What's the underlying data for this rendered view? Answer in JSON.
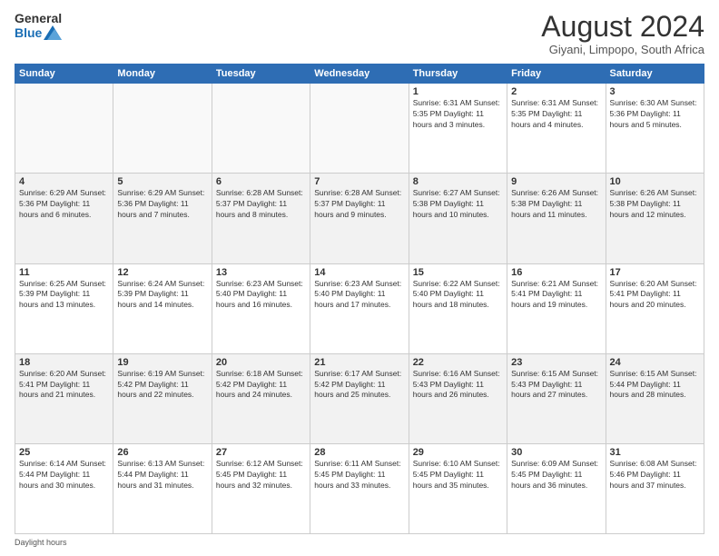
{
  "header": {
    "logo_general": "General",
    "logo_blue": "Blue",
    "title": "August 2024",
    "subtitle": "Giyani, Limpopo, South Africa"
  },
  "calendar": {
    "days_of_week": [
      "Sunday",
      "Monday",
      "Tuesday",
      "Wednesday",
      "Thursday",
      "Friday",
      "Saturday"
    ],
    "weeks": [
      [
        {
          "day": "",
          "info": "",
          "empty": true
        },
        {
          "day": "",
          "info": "",
          "empty": true
        },
        {
          "day": "",
          "info": "",
          "empty": true
        },
        {
          "day": "",
          "info": "",
          "empty": true
        },
        {
          "day": "1",
          "info": "Sunrise: 6:31 AM\nSunset: 5:35 PM\nDaylight: 11 hours\nand 3 minutes.",
          "empty": false
        },
        {
          "day": "2",
          "info": "Sunrise: 6:31 AM\nSunset: 5:35 PM\nDaylight: 11 hours\nand 4 minutes.",
          "empty": false
        },
        {
          "day": "3",
          "info": "Sunrise: 6:30 AM\nSunset: 5:36 PM\nDaylight: 11 hours\nand 5 minutes.",
          "empty": false
        }
      ],
      [
        {
          "day": "4",
          "info": "Sunrise: 6:29 AM\nSunset: 5:36 PM\nDaylight: 11 hours\nand 6 minutes.",
          "empty": false
        },
        {
          "day": "5",
          "info": "Sunrise: 6:29 AM\nSunset: 5:36 PM\nDaylight: 11 hours\nand 7 minutes.",
          "empty": false
        },
        {
          "day": "6",
          "info": "Sunrise: 6:28 AM\nSunset: 5:37 PM\nDaylight: 11 hours\nand 8 minutes.",
          "empty": false
        },
        {
          "day": "7",
          "info": "Sunrise: 6:28 AM\nSunset: 5:37 PM\nDaylight: 11 hours\nand 9 minutes.",
          "empty": false
        },
        {
          "day": "8",
          "info": "Sunrise: 6:27 AM\nSunset: 5:38 PM\nDaylight: 11 hours\nand 10 minutes.",
          "empty": false
        },
        {
          "day": "9",
          "info": "Sunrise: 6:26 AM\nSunset: 5:38 PM\nDaylight: 11 hours\nand 11 minutes.",
          "empty": false
        },
        {
          "day": "10",
          "info": "Sunrise: 6:26 AM\nSunset: 5:38 PM\nDaylight: 11 hours\nand 12 minutes.",
          "empty": false
        }
      ],
      [
        {
          "day": "11",
          "info": "Sunrise: 6:25 AM\nSunset: 5:39 PM\nDaylight: 11 hours\nand 13 minutes.",
          "empty": false
        },
        {
          "day": "12",
          "info": "Sunrise: 6:24 AM\nSunset: 5:39 PM\nDaylight: 11 hours\nand 14 minutes.",
          "empty": false
        },
        {
          "day": "13",
          "info": "Sunrise: 6:23 AM\nSunset: 5:40 PM\nDaylight: 11 hours\nand 16 minutes.",
          "empty": false
        },
        {
          "day": "14",
          "info": "Sunrise: 6:23 AM\nSunset: 5:40 PM\nDaylight: 11 hours\nand 17 minutes.",
          "empty": false
        },
        {
          "day": "15",
          "info": "Sunrise: 6:22 AM\nSunset: 5:40 PM\nDaylight: 11 hours\nand 18 minutes.",
          "empty": false
        },
        {
          "day": "16",
          "info": "Sunrise: 6:21 AM\nSunset: 5:41 PM\nDaylight: 11 hours\nand 19 minutes.",
          "empty": false
        },
        {
          "day": "17",
          "info": "Sunrise: 6:20 AM\nSunset: 5:41 PM\nDaylight: 11 hours\nand 20 minutes.",
          "empty": false
        }
      ],
      [
        {
          "day": "18",
          "info": "Sunrise: 6:20 AM\nSunset: 5:41 PM\nDaylight: 11 hours\nand 21 minutes.",
          "empty": false
        },
        {
          "day": "19",
          "info": "Sunrise: 6:19 AM\nSunset: 5:42 PM\nDaylight: 11 hours\nand 22 minutes.",
          "empty": false
        },
        {
          "day": "20",
          "info": "Sunrise: 6:18 AM\nSunset: 5:42 PM\nDaylight: 11 hours\nand 24 minutes.",
          "empty": false
        },
        {
          "day": "21",
          "info": "Sunrise: 6:17 AM\nSunset: 5:42 PM\nDaylight: 11 hours\nand 25 minutes.",
          "empty": false
        },
        {
          "day": "22",
          "info": "Sunrise: 6:16 AM\nSunset: 5:43 PM\nDaylight: 11 hours\nand 26 minutes.",
          "empty": false
        },
        {
          "day": "23",
          "info": "Sunrise: 6:15 AM\nSunset: 5:43 PM\nDaylight: 11 hours\nand 27 minutes.",
          "empty": false
        },
        {
          "day": "24",
          "info": "Sunrise: 6:15 AM\nSunset: 5:44 PM\nDaylight: 11 hours\nand 28 minutes.",
          "empty": false
        }
      ],
      [
        {
          "day": "25",
          "info": "Sunrise: 6:14 AM\nSunset: 5:44 PM\nDaylight: 11 hours\nand 30 minutes.",
          "empty": false
        },
        {
          "day": "26",
          "info": "Sunrise: 6:13 AM\nSunset: 5:44 PM\nDaylight: 11 hours\nand 31 minutes.",
          "empty": false
        },
        {
          "day": "27",
          "info": "Sunrise: 6:12 AM\nSunset: 5:45 PM\nDaylight: 11 hours\nand 32 minutes.",
          "empty": false
        },
        {
          "day": "28",
          "info": "Sunrise: 6:11 AM\nSunset: 5:45 PM\nDaylight: 11 hours\nand 33 minutes.",
          "empty": false
        },
        {
          "day": "29",
          "info": "Sunrise: 6:10 AM\nSunset: 5:45 PM\nDaylight: 11 hours\nand 35 minutes.",
          "empty": false
        },
        {
          "day": "30",
          "info": "Sunrise: 6:09 AM\nSunset: 5:45 PM\nDaylight: 11 hours\nand 36 minutes.",
          "empty": false
        },
        {
          "day": "31",
          "info": "Sunrise: 6:08 AM\nSunset: 5:46 PM\nDaylight: 11 hours\nand 37 minutes.",
          "empty": false
        }
      ]
    ]
  },
  "footer": {
    "note": "Daylight hours"
  }
}
